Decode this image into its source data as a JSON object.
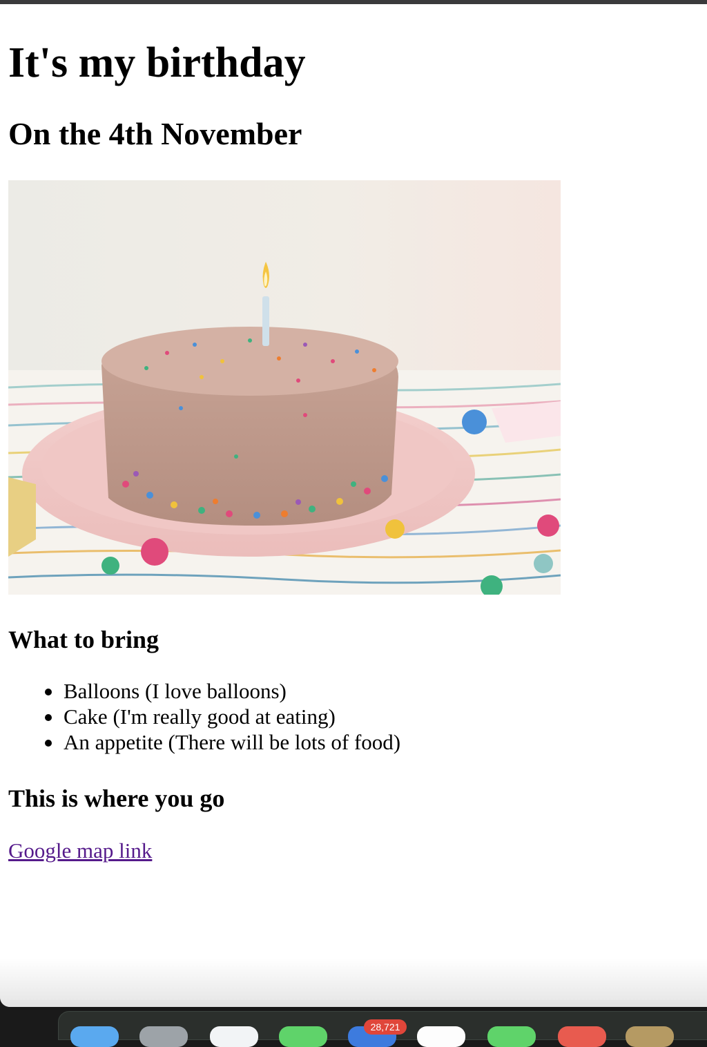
{
  "page": {
    "heading": "It's my birthday",
    "subheading": "On the 4th November",
    "bring_heading": "What to bring",
    "bring_items": [
      "Balloons (I love balloons)",
      "Cake (I'm really good at eating)",
      "An appetite (There will be lots of food)"
    ],
    "where_heading": "This is where you go",
    "map_link_text": "Google map link"
  },
  "dock": {
    "badge": "28,721",
    "icons": [
      "finder-icon",
      "launchpad-icon",
      "safari-icon",
      "messages-icon",
      "mail-icon",
      "photos-icon",
      "facetime-icon",
      "calendar-icon",
      "notes-icon"
    ]
  },
  "colors": {
    "link_visited": "#551a8b",
    "text": "#000000",
    "background": "#ffffff"
  }
}
